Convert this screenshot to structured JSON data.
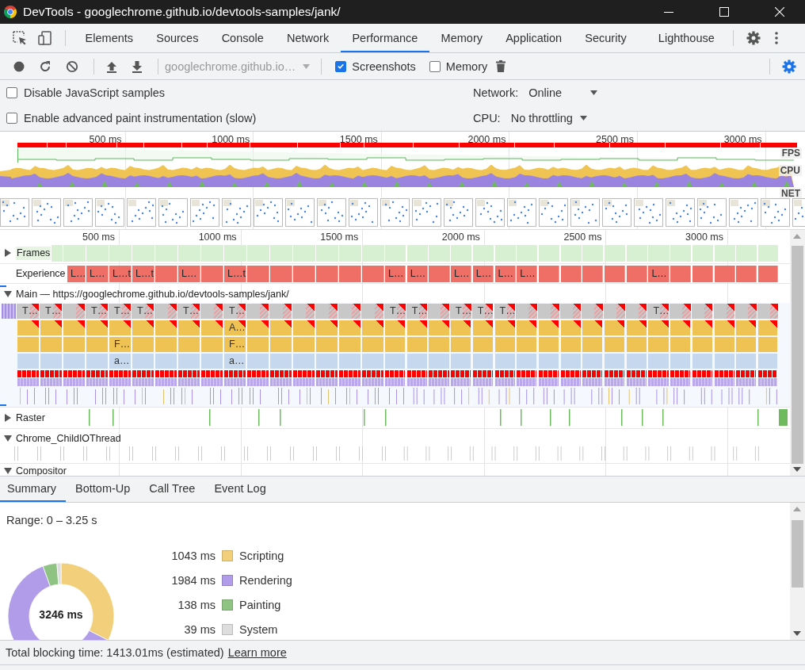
{
  "window": {
    "title": "DevTools - googlechrome.github.io/devtools-samples/jank/"
  },
  "tabs": [
    {
      "label": "Elements",
      "selected": false
    },
    {
      "label": "Sources",
      "selected": false
    },
    {
      "label": "Console",
      "selected": false
    },
    {
      "label": "Network",
      "selected": false
    },
    {
      "label": "Performance",
      "selected": true
    },
    {
      "label": "Memory",
      "selected": false
    },
    {
      "label": "Application",
      "selected": false
    },
    {
      "label": "Security",
      "selected": false
    },
    {
      "label": "Lighthouse",
      "selected": false
    }
  ],
  "toolbar": {
    "target": {
      "value": "googlechrome.github.io…",
      "disabled": true
    },
    "toggles": [
      {
        "label": "Screenshots",
        "checked": true
      },
      {
        "label": "Memory",
        "checked": false
      }
    ]
  },
  "capture_settings": {
    "options": [
      {
        "label": "Disable JavaScript samples",
        "checked": false
      },
      {
        "label": "Enable advanced paint instrumentation (slow)",
        "checked": false
      }
    ],
    "throttling": [
      {
        "label": "Network:",
        "value": "Online"
      },
      {
        "label": "CPU:",
        "value": "No throttling"
      }
    ]
  },
  "overview": {
    "ticks": [
      "500 ms",
      "1000 ms",
      "1500 ms",
      "2000 ms",
      "2500 ms",
      "3000 ms"
    ],
    "tracks": [
      "FPS",
      "CPU",
      "NET"
    ]
  },
  "timeline": {
    "ticks": [
      "500 ms",
      "1000 ms",
      "1500 ms",
      "2000 ms",
      "2500 ms",
      "3000 ms"
    ],
    "tracks": [
      {
        "kind": "frames",
        "label": "Frames",
        "expanded": false
      },
      {
        "kind": "experience",
        "label": "Experience"
      },
      {
        "kind": "main",
        "label": "Main — https://googlechrome.github.io/devtools-samples/jank/",
        "expanded": true
      },
      {
        "kind": "raster",
        "label": "Raster",
        "expanded": false
      },
      {
        "kind": "thread",
        "label": "Chrome_ChildIOThread",
        "expanded": true
      },
      {
        "kind": "thread",
        "label": "Compositor",
        "expanded": true
      }
    ],
    "task_columns": [
      {
        "long_task": true,
        "task": "T…"
      },
      {
        "long_task": true,
        "task": "T…"
      },
      {
        "long_task": true,
        "experience": "L…"
      },
      {
        "long_task": true,
        "task": "T…",
        "experience": "L…"
      },
      {
        "long_task": true,
        "task": "T…",
        "experience": "L…t",
        "call_2": "F…",
        "call_3": "a…"
      },
      {
        "long_task": true,
        "task": "T…",
        "experience": "L…t"
      },
      {
        "long_task": true
      },
      {
        "long_task": true,
        "task": "T…",
        "experience": "L…"
      },
      {
        "long_task": true
      },
      {
        "long_task": true,
        "task": "T…",
        "experience": "L…t",
        "call_1": "A…",
        "call_2": "F…",
        "call_3": "a…"
      },
      {
        "long_task": true
      },
      {
        "long_task": true
      },
      {
        "long_task": true
      },
      {
        "long_task": true
      },
      {
        "long_task": true
      },
      {
        "long_task": true
      },
      {
        "long_task": true,
        "task": "T…",
        "experience": "L…"
      },
      {
        "long_task": true,
        "task": "T…",
        "experience": "L…"
      },
      {
        "long_task": true
      },
      {
        "long_task": true,
        "task": "T…",
        "experience": "L…"
      },
      {
        "long_task": true,
        "task": "T…",
        "experience": "L…"
      },
      {
        "long_task": true,
        "task": "T…",
        "experience": "L…"
      },
      {
        "long_task": true,
        "experience": "L…"
      },
      {
        "long_task": true
      },
      {
        "long_task": true
      },
      {
        "long_task": true
      },
      {
        "long_task": true
      },
      {
        "long_task": true
      },
      {
        "long_task": true,
        "task": "T…",
        "experience": "L…"
      },
      {
        "long_task": true
      },
      {
        "long_task": true
      },
      {
        "long_task": true
      },
      {
        "long_task": true
      },
      {
        "long_task": true
      }
    ]
  },
  "details_tabs": [
    {
      "label": "Summary",
      "selected": true
    },
    {
      "label": "Bottom-Up",
      "selected": false
    },
    {
      "label": "Call Tree",
      "selected": false
    },
    {
      "label": "Event Log",
      "selected": false
    }
  ],
  "summary": {
    "range": "Range: 0 – 3.25 s",
    "total": "3246 ms",
    "legend": [
      {
        "value": "1043 ms",
        "color": "#f2cf7a"
      },
      {
        "value": "1984 ms",
        "color": "#b09ce8"
      },
      {
        "value": "138 ms",
        "color": "#8fc383"
      },
      {
        "value": "39 ms",
        "color": "#dddddd"
      }
    ],
    "chart_data": {
      "type": "donut",
      "categories": [
        "Scripting",
        "Rendering",
        "Painting",
        "System"
      ],
      "values": [
        32.55,
        61.92,
        4.31,
        1.22
      ]
    }
  },
  "status_bar": {
    "text": "Total blocking time: 1413.01ms (estimated)",
    "link": "Learn more"
  }
}
